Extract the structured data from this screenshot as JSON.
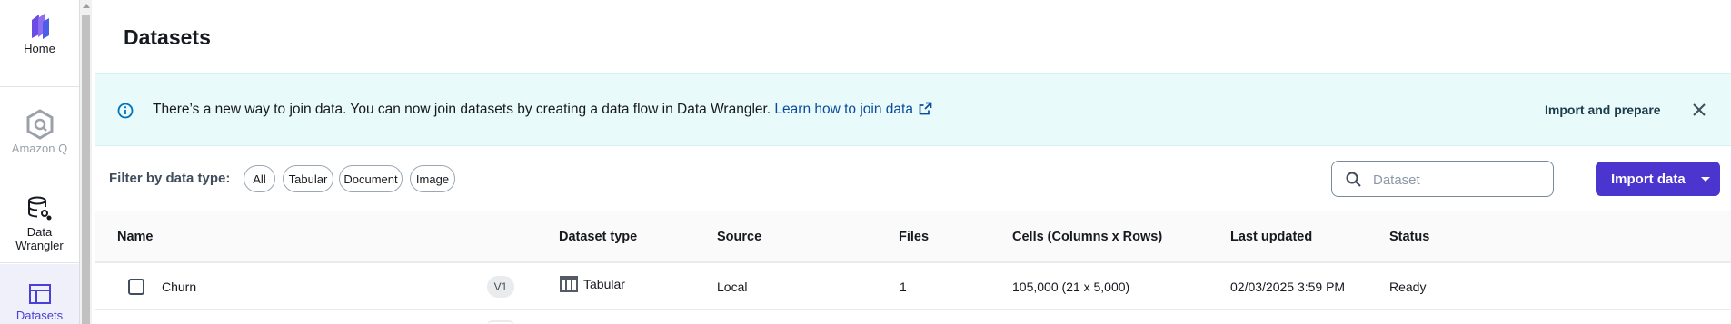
{
  "sidebar": {
    "items": [
      {
        "label": "Home",
        "icon": "home-icon"
      },
      {
        "label": "Amazon Q",
        "icon": "amazon-q-icon"
      },
      {
        "label_line1": "Data",
        "label_line2": "Wrangler",
        "icon": "data-wrangler-icon"
      },
      {
        "label": "Datasets",
        "icon": "datasets-icon"
      }
    ]
  },
  "page": {
    "title": "Datasets"
  },
  "banner": {
    "message": "There’s a new way to join data. You can now join datasets by creating a data flow in Data Wrangler. ",
    "link_text": "Learn how to join data",
    "action_label": "Import and prepare",
    "icon": "info-icon",
    "close_icon": "close-icon"
  },
  "filters": {
    "label": "Filter by data type:",
    "chips": [
      "All",
      "Tabular",
      "Document",
      "Image"
    ]
  },
  "search": {
    "placeholder": "Dataset"
  },
  "import_button": {
    "label": "Import data"
  },
  "table": {
    "columns": [
      "Name",
      "Dataset type",
      "Source",
      "Files",
      "Cells (Columns x Rows)",
      "Last updated",
      "Status"
    ],
    "rows": [
      {
        "name": "Churn",
        "version": "V1",
        "type": "Tabular",
        "source": "Local",
        "files": "1",
        "cells": "105,000 (21 x 5,000)",
        "last_updated": "02/03/2025 3:59 PM",
        "status": "Ready"
      }
    ]
  },
  "colors": {
    "accent": "#4a35cf",
    "banner_bg": "#e8fafa",
    "link": "#0a4a9e",
    "info": "#0073bb"
  }
}
